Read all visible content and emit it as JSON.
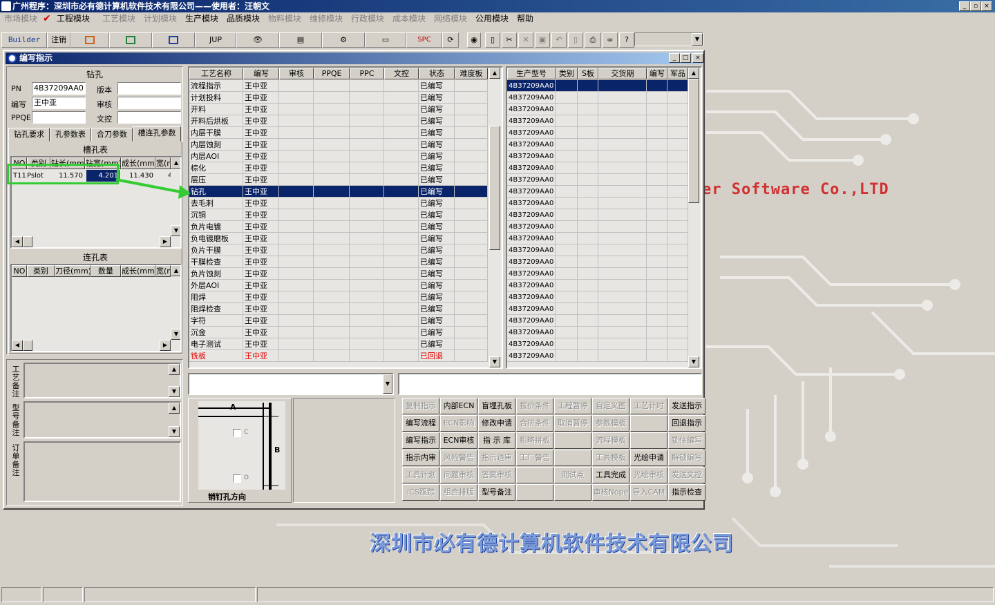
{
  "app": {
    "title": "广州程序：深圳市必有德计算机软件技术有限公司——使用者：汪朝文",
    "window_controls": [
      "_",
      "▫",
      "×"
    ]
  },
  "menu": [
    {
      "label": "市场模块",
      "enabled": false
    },
    {
      "label": "工程模块",
      "enabled": true,
      "checked": true
    },
    {
      "label": "工艺模块",
      "enabled": false
    },
    {
      "label": "计划模块",
      "enabled": false
    },
    {
      "label": "生产模块",
      "enabled": true
    },
    {
      "label": "品质模块",
      "enabled": true
    },
    {
      "label": "物料模块",
      "enabled": false
    },
    {
      "label": "维修模块",
      "enabled": false
    },
    {
      "label": "行政模块",
      "enabled": false
    },
    {
      "label": "成本模块",
      "enabled": false
    },
    {
      "label": "网络模块",
      "enabled": false
    },
    {
      "label": "公用模块",
      "enabled": true
    },
    {
      "label": "帮助",
      "enabled": true
    }
  ],
  "toolbar": {
    "builder": "Builder",
    "logout": "注销",
    "jup": "JUP",
    "spc": "SPC"
  },
  "dialog": {
    "title": "编写指示",
    "controls": [
      "_",
      "□",
      "×"
    ]
  },
  "drill": {
    "section_title": "钻孔",
    "pn_label": "PN",
    "pn_value": "4B37209AA0",
    "version_label": "版本",
    "version_value": "",
    "author_label": "编写",
    "author_value": "王中亚",
    "review_label": "审核",
    "review_value": "",
    "ppqe_label": "PPQE",
    "ppqe_value": "",
    "doc_control_label": "文控",
    "doc_control_value": "",
    "tabs": [
      "钻孔要求",
      "孔参数表",
      "合刀参数",
      "槽连孔参数"
    ],
    "active_tab": 3,
    "slot_table_title": "槽孔表",
    "slot_headers": [
      "NO",
      "类别",
      "钻长(mm)",
      "钻宽(mm)",
      "成长(mm)",
      "宽(m"
    ],
    "slot_rows": [
      [
        "T11",
        "Pslot",
        "11.570",
        "4.201",
        "11.430",
        "4"
      ]
    ],
    "link_table_title": "连孔表",
    "link_headers": [
      "NO",
      "类别",
      "刀径(mm)",
      "数量",
      "成长(mm)",
      "宽(m"
    ]
  },
  "remarks": {
    "process_note": "工艺备注",
    "model_note": "型号备注",
    "order_note": "订单备注"
  },
  "process_table": {
    "headers": [
      "工艺名称",
      "编写",
      "审核",
      "PPQE",
      "PPC",
      "文控",
      "状态",
      "难度板"
    ],
    "rows": [
      {
        "name": "流程指示",
        "author": "王中亚",
        "status": "已编写"
      },
      {
        "name": "计划投料",
        "author": "王中亚",
        "status": "已编写"
      },
      {
        "name": "开料",
        "author": "王中亚",
        "status": "已编写"
      },
      {
        "name": "开料后烘板",
        "author": "王中亚",
        "status": "已编写"
      },
      {
        "name": "内层干膜",
        "author": "王中亚",
        "status": "已编写"
      },
      {
        "name": "内层蚀刻",
        "author": "王中亚",
        "status": "已编写"
      },
      {
        "name": "内层AOI",
        "author": "王中亚",
        "status": "已编写"
      },
      {
        "name": "棕化",
        "author": "王中亚",
        "status": "已编写"
      },
      {
        "name": "层压",
        "author": "王中亚",
        "status": "已编写"
      },
      {
        "name": "钻孔",
        "author": "王中亚",
        "status": "已编写",
        "selected": true
      },
      {
        "name": "去毛刺",
        "author": "王中亚",
        "status": "已编写"
      },
      {
        "name": "沉铜",
        "author": "王中亚",
        "status": "已编写"
      },
      {
        "name": "负片电镀",
        "author": "王中亚",
        "status": "已编写"
      },
      {
        "name": "负电镀磨板",
        "author": "王中亚",
        "status": "已编写"
      },
      {
        "name": "负片干膜",
        "author": "王中亚",
        "status": "已编写"
      },
      {
        "name": "干膜检查",
        "author": "王中亚",
        "status": "已编写"
      },
      {
        "name": "负片蚀刻",
        "author": "王中亚",
        "status": "已编写"
      },
      {
        "name": "外层AOI",
        "author": "王中亚",
        "status": "已编写"
      },
      {
        "name": "阻焊",
        "author": "王中亚",
        "status": "已编写"
      },
      {
        "name": "阻焊检查",
        "author": "王中亚",
        "status": "已编写"
      },
      {
        "name": "字符",
        "author": "王中亚",
        "status": "已编写"
      },
      {
        "name": "沉金",
        "author": "王中亚",
        "status": "已编写"
      },
      {
        "name": "电子测试",
        "author": "王中亚",
        "status": "已编写"
      },
      {
        "name": "铣板",
        "author": "王中亚",
        "status": "已回退",
        "returned": true
      }
    ]
  },
  "model_table": {
    "headers": [
      "生产型号",
      "类别",
      "S板",
      "交货期",
      "编写",
      "军品"
    ],
    "rows": [
      "4B37209AA0",
      "4B37209AA0",
      "4B37209AA0",
      "4B37209AA0",
      "4B37209AA0",
      "4B37209AA0",
      "4B37209AA0",
      "4B37209AA0",
      "4B37209AA0",
      "4B37209AA0",
      "4B37209AA0",
      "4B37209AA0",
      "4B37209AA0",
      "4B37209AA0",
      "4B37209AA0",
      "4B37209AA0",
      "4B37209AA0",
      "4B37209AA0",
      "4B37209AA0",
      "4B37209AA0",
      "4B37209AA0",
      "4B37209AA0",
      "4B37209AA0",
      "4B37209AA0"
    ]
  },
  "pin_diagram": {
    "label_a": "A",
    "label_b": "B",
    "check_c": "C",
    "check_d": "D",
    "caption": "销钉孔方向"
  },
  "actions": [
    [
      {
        "label": "复制指示",
        "enabled": false
      },
      {
        "label": "内部ECN",
        "enabled": true
      },
      {
        "label": "盲埋孔板",
        "enabled": true
      },
      {
        "label": "报价条件",
        "enabled": false
      },
      {
        "label": "工程暂停",
        "enabled": false
      },
      {
        "label": "自定义图",
        "enabled": false
      },
      {
        "label": "工艺计时",
        "enabled": false
      },
      {
        "label": "发送指示",
        "enabled": true
      }
    ],
    [
      {
        "label": "编写流程",
        "enabled": true
      },
      {
        "label": "ECN影响",
        "enabled": false
      },
      {
        "label": "修改申请",
        "enabled": true
      },
      {
        "label": "合拼条件",
        "enabled": false
      },
      {
        "label": "取消暂停",
        "enabled": false
      },
      {
        "label": "参数模板",
        "enabled": false
      },
      {
        "label": "",
        "enabled": false
      },
      {
        "label": "回退指示",
        "enabled": true
      }
    ],
    [
      {
        "label": "编写指示",
        "enabled": true
      },
      {
        "label": "ECN审核",
        "enabled": true
      },
      {
        "label": "指 示 库",
        "enabled": true
      },
      {
        "label": "粗略拼板",
        "enabled": false
      },
      {
        "label": "",
        "enabled": false
      },
      {
        "label": "流程模板",
        "enabled": false
      },
      {
        "label": "",
        "enabled": false
      },
      {
        "label": "锁住编写",
        "enabled": false
      }
    ],
    [
      {
        "label": "指示内审",
        "enabled": true
      },
      {
        "label": "风险警告",
        "enabled": false
      },
      {
        "label": "指示退审",
        "enabled": false
      },
      {
        "label": "工厂警告",
        "enabled": false
      },
      {
        "label": "",
        "enabled": false
      },
      {
        "label": "工具模板",
        "enabled": false
      },
      {
        "label": "光绘申请",
        "enabled": true
      },
      {
        "label": "解锁编写",
        "enabled": false
      }
    ],
    [
      {
        "label": "工具计划",
        "enabled": false
      },
      {
        "label": "问题审核",
        "enabled": false
      },
      {
        "label": "答案审核",
        "enabled": false
      },
      {
        "label": "",
        "enabled": false
      },
      {
        "label": "测试点",
        "enabled": false
      },
      {
        "label": "工具完成",
        "enabled": true
      },
      {
        "label": "光绘审核",
        "enabled": false
      },
      {
        "label": "发送文控",
        "enabled": false
      }
    ],
    [
      {
        "label": "ICS跟踪",
        "enabled": false
      },
      {
        "label": "组合排版",
        "enabled": false
      },
      {
        "label": "型号备注",
        "enabled": true
      },
      {
        "label": "",
        "enabled": false
      },
      {
        "label": "",
        "enabled": false
      },
      {
        "label": "审核Nope",
        "enabled": false
      },
      {
        "label": "导入CAM",
        "enabled": false
      },
      {
        "label": "指示检查",
        "enabled": true
      }
    ]
  ],
  "background": {
    "company_en": "er Software Co.,LTD",
    "company_cn": "深圳市必有德计算机软件技术有限公司"
  },
  "colors": {
    "titlebar": "#0a246a",
    "selection": "#0a246a",
    "returned_text": "#e00000",
    "highlight_arrow": "#33cc33"
  }
}
